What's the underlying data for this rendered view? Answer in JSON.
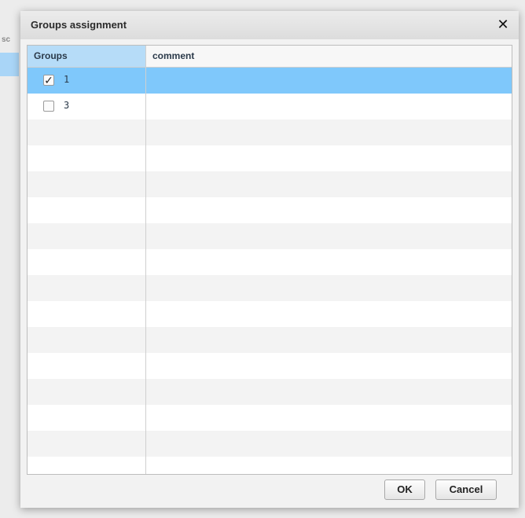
{
  "dialog": {
    "title": "Groups assignment",
    "close_label": "✕"
  },
  "grid": {
    "columns": [
      "Groups",
      "comment"
    ],
    "rows": [
      {
        "checked": true,
        "checkmark": "✓",
        "group": "1",
        "comment": ""
      },
      {
        "checked": false,
        "checkmark": "",
        "group": "3",
        "comment": ""
      }
    ],
    "selected_color": "#7fc8fb"
  },
  "buttons": {
    "ok": "OK",
    "cancel": "Cancel"
  }
}
